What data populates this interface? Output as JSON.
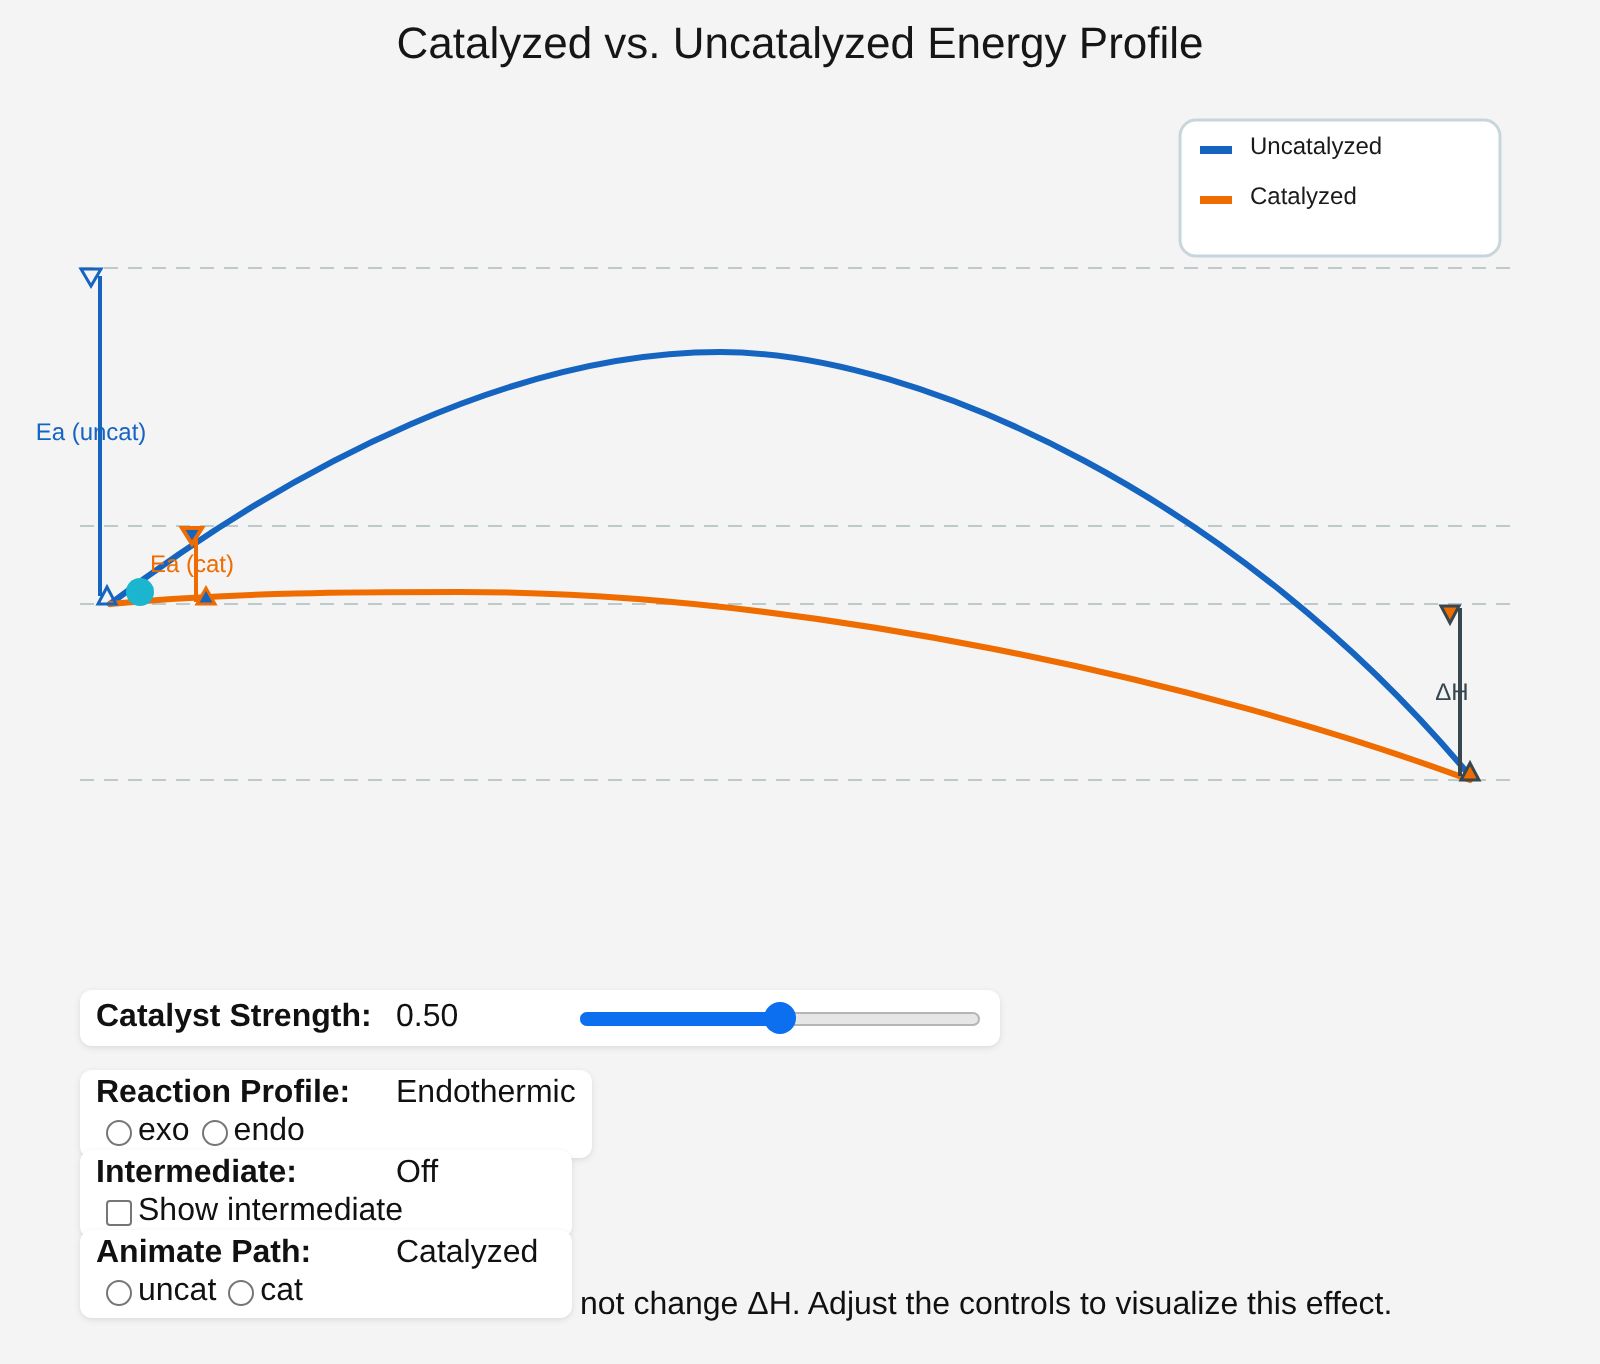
{
  "title": "Catalyzed vs. Uncatalyzed Energy Profile",
  "chart": {
    "legend": [
      {
        "label": "Uncatalyzed",
        "color": "#1565c0"
      },
      {
        "label": "Catalyzed",
        "color": "#ef6c00"
      }
    ],
    "annotations": {
      "ea_uncatalyzed": "Ea (uncat)",
      "ea_catalyzed": "Ea (cat)",
      "delta_h": "ΔH"
    }
  },
  "controls": [
    {
      "kind": "slider",
      "label": "Catalyst Strength:",
      "value": "0.50",
      "level": 0.5
    },
    {
      "kind": "radio",
      "label": "Reaction Profile:",
      "value": "Endothermic",
      "options": [
        {
          "label": "exo",
          "selected": false
        },
        {
          "label": "endo",
          "selected": false
        }
      ]
    },
    {
      "kind": "checkbox",
      "label": "Intermediate:",
      "value": "Off",
      "option": {
        "label": "Show intermediate",
        "checked": false
      }
    },
    {
      "kind": "radio",
      "label": "Animate Path:",
      "value": "Catalyzed",
      "options": [
        {
          "label": "uncat",
          "selected": false
        },
        {
          "label": "cat",
          "selected": false
        }
      ]
    }
  ],
  "footnote": "not change ΔH. Adjust the controls to visualize this effect."
}
